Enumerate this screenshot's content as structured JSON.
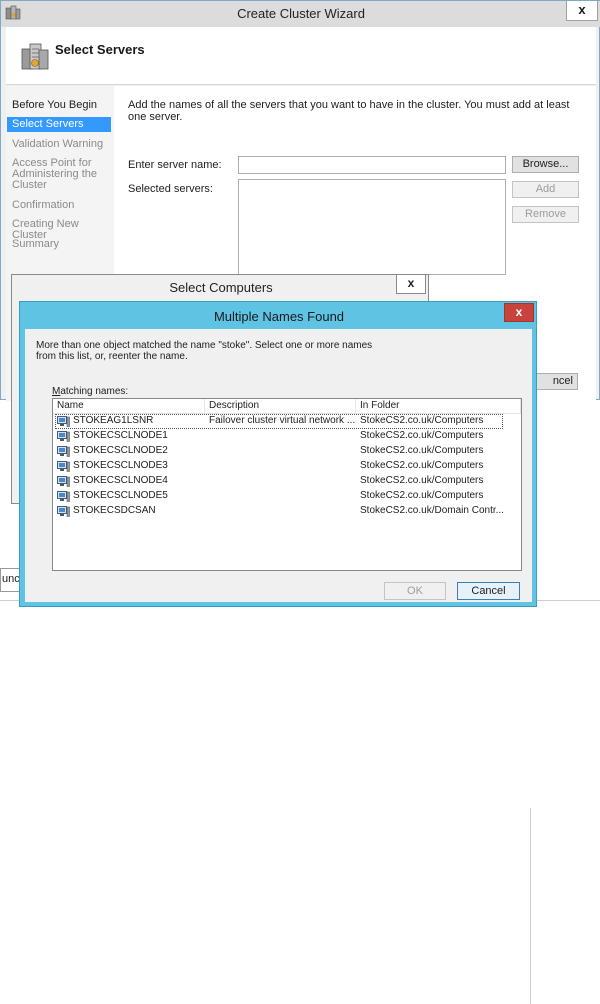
{
  "wizard": {
    "title": "Create Cluster Wizard",
    "close_label": "x",
    "header_title": "Select Servers",
    "steps": [
      {
        "label": "Before You Begin",
        "state": "done"
      },
      {
        "label": "Select Servers",
        "state": "active"
      },
      {
        "label": "Validation Warning",
        "state": "pending"
      },
      {
        "label": "Access Point for Administering the Cluster",
        "state": "pending"
      },
      {
        "label": "Confirmation",
        "state": "pending"
      },
      {
        "label": "Creating New Cluster",
        "state": "pending"
      },
      {
        "label": "Summary",
        "state": "pending"
      }
    ],
    "instruction": "Add the names of all the servers that you want to have in the cluster. You must add at least one server.",
    "enter_server_label": "Enter server name:",
    "server_name_value": "",
    "selected_servers_label": "Selected servers:",
    "browse_label": "Browse...",
    "add_label": "Add",
    "remove_label": "Remove",
    "cancel_label": "ncel"
  },
  "select_computers": {
    "title": "Select Computers",
    "close_label": "x"
  },
  "background": {
    "strip_text": "unc"
  },
  "multiple_names": {
    "title": "Multiple Names Found",
    "close_label": "x",
    "message": "More than one object matched the name \"stoke\". Select one or more names from this list, or, reenter the name.",
    "matching_label_prefix": "M",
    "matching_label_rest": "atching names:",
    "columns": {
      "name": "Name",
      "description": "Description",
      "folder": "In Folder"
    },
    "rows": [
      {
        "name": "STOKEAG1LSNR",
        "description": "Failover cluster virtual network ...",
        "folder": "StokeCS2.co.uk/Computers"
      },
      {
        "name": "STOKECSCLNODE1",
        "description": "",
        "folder": "StokeCS2.co.uk/Computers"
      },
      {
        "name": "STOKECSCLNODE2",
        "description": "",
        "folder": "StokeCS2.co.uk/Computers"
      },
      {
        "name": "STOKECSCLNODE3",
        "description": "",
        "folder": "StokeCS2.co.uk/Computers"
      },
      {
        "name": "STOKECSCLNODE4",
        "description": "",
        "folder": "StokeCS2.co.uk/Computers"
      },
      {
        "name": "STOKECSCLNODE5",
        "description": "",
        "folder": "StokeCS2.co.uk/Computers"
      },
      {
        "name": "STOKECSDCSAN",
        "description": "",
        "folder": "StokeCS2.co.uk/Domain Contr..."
      }
    ],
    "ok_label": "OK",
    "cancel_label": "Cancel"
  },
  "colors": {
    "selection": "#3399ff",
    "dialog_frame": "#5fc3e4",
    "close_button": "#c7433c"
  },
  "icons": {
    "wizard_app": "cluster-icon",
    "header": "servers-icon",
    "row": "computer-icon"
  }
}
